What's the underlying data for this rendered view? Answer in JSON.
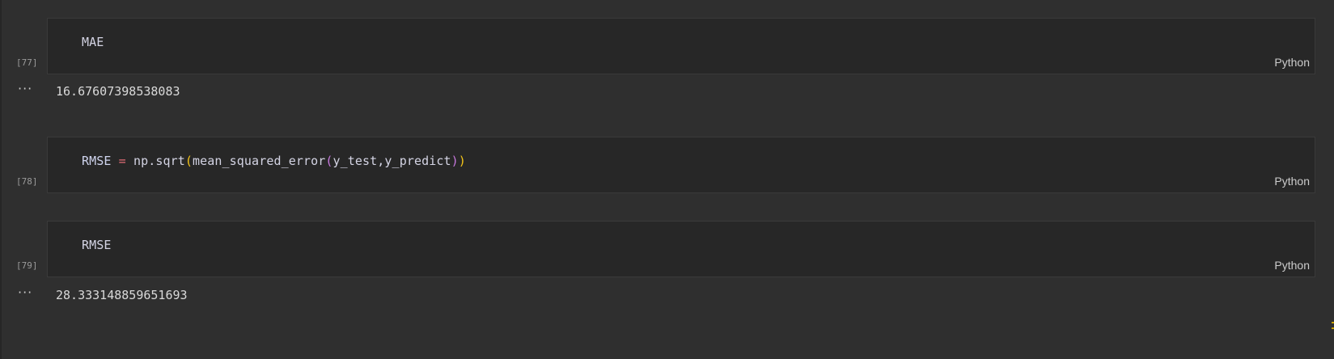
{
  "cells": [
    {
      "exec_count": "[77]",
      "source": "MAE",
      "language": "Python",
      "output_menu": "···",
      "output": "16.67607398538083"
    },
    {
      "exec_count": "[78]",
      "source_tokens": {
        "var": "RMSE",
        "op": "=",
        "call": "np.sqrt",
        "paren_open_outer": "(",
        "inner_fn": "mean_squared_error",
        "paren_open_inner": "(",
        "args": "y_test,y_predict",
        "paren_close_inner": ")",
        "paren_close_outer": ")"
      },
      "language": "Python"
    },
    {
      "exec_count": "[79]",
      "source": "RMSE",
      "language": "Python",
      "output_menu": "···",
      "output": "28.333148859651693"
    }
  ],
  "colors": {
    "background": "#2f2f2f",
    "cell_background": "#272727",
    "operator": "#e06c75",
    "paren_outer": "#f5c518",
    "paren_inner": "#c678dd"
  }
}
